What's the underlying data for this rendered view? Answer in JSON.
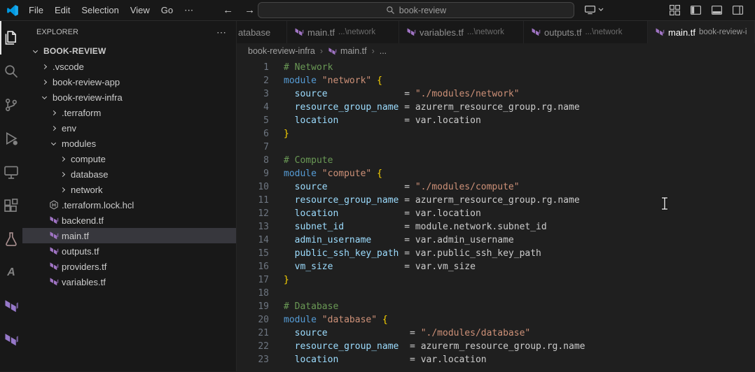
{
  "colors": {
    "tf-purple": "#a074c4",
    "c-comment": "#6a9955",
    "c-keyword": "#569cd6",
    "c-string": "#ce9178",
    "c-bracket": "#ffd700",
    "c-prop": "#9cdcfe",
    "c-plain": "#cccccc"
  },
  "titlebar": {
    "menus": [
      {
        "key": "file",
        "label": "File"
      },
      {
        "key": "edit",
        "label": "Edit"
      },
      {
        "key": "selection",
        "label": "Selection"
      },
      {
        "key": "view",
        "label": "View"
      },
      {
        "key": "go",
        "label": "Go"
      },
      {
        "key": "more",
        "label": "⋯"
      }
    ],
    "back_arrow": "←",
    "forward_arrow": "→",
    "search_value": "book-review"
  },
  "activitybar": {
    "items": [
      {
        "name": "explorer",
        "icon": "files",
        "active": true
      },
      {
        "name": "search",
        "icon": "search"
      },
      {
        "name": "source-control",
        "icon": "scm"
      },
      {
        "name": "run-debug",
        "icon": "debug"
      },
      {
        "name": "remote-explorer",
        "icon": "remote"
      },
      {
        "name": "extensions",
        "icon": "ext"
      },
      {
        "name": "testing",
        "icon": "flask",
        "color": "#a98f8f"
      },
      {
        "name": "azure-terraform",
        "icon": "letterA"
      },
      {
        "name": "terraform",
        "icon": "tf",
        "color": "#9678c9"
      },
      {
        "name": "terraform-cloud",
        "icon": "tf",
        "color": "#9678c9"
      }
    ]
  },
  "sidebar": {
    "title": "EXPLORER",
    "more": "⋯",
    "tree": [
      {
        "label": "BOOK-REVIEW",
        "depth": 0,
        "type": "folder",
        "chevron": "down",
        "bold": true
      },
      {
        "label": ".vscode",
        "depth": 1,
        "type": "folder",
        "chevron": "right"
      },
      {
        "label": "book-review-app",
        "depth": 1,
        "type": "folder",
        "chevron": "right"
      },
      {
        "label": "book-review-infra",
        "depth": 1,
        "type": "folder",
        "chevron": "down"
      },
      {
        "label": ".terraform",
        "depth": 2,
        "type": "folder",
        "chevron": "right"
      },
      {
        "label": "env",
        "depth": 2,
        "type": "folder",
        "chevron": "right"
      },
      {
        "label": "modules",
        "depth": 2,
        "type": "folder",
        "chevron": "down"
      },
      {
        "label": "compute",
        "depth": 3,
        "type": "folder",
        "chevron": "right"
      },
      {
        "label": "database",
        "depth": 3,
        "type": "folder",
        "chevron": "right"
      },
      {
        "label": "network",
        "depth": 3,
        "type": "folder",
        "chevron": "right"
      },
      {
        "label": ".terraform.lock.hcl",
        "depth": 2,
        "type": "file",
        "icon": "hcl"
      },
      {
        "label": "backend.tf",
        "depth": 2,
        "type": "file",
        "icon": "terraform"
      },
      {
        "label": "main.tf",
        "depth": 2,
        "type": "file",
        "icon": "terraform",
        "selected": true
      },
      {
        "label": "outputs.tf",
        "depth": 2,
        "type": "file",
        "icon": "terraform"
      },
      {
        "label": "providers.tf",
        "depth": 2,
        "type": "file",
        "icon": "terraform"
      },
      {
        "label": "variables.tf",
        "depth": 2,
        "type": "file",
        "icon": "terraform"
      }
    ]
  },
  "tabs": [
    {
      "label": "atabase",
      "desc": "",
      "icon": false,
      "active": false,
      "partial": true
    },
    {
      "label": "main.tf",
      "desc": "...\\network",
      "icon": true,
      "active": false
    },
    {
      "label": "variables.tf",
      "desc": "...\\network",
      "icon": true,
      "active": false
    },
    {
      "label": "outputs.tf",
      "desc": "...\\network",
      "icon": true,
      "active": false
    },
    {
      "label": "main.tf",
      "desc": "book-review-i",
      "icon": true,
      "active": true
    }
  ],
  "breadcrumb": {
    "items": [
      {
        "label": "book-review-infra",
        "icon": false
      },
      {
        "label": "main.tf",
        "icon": true
      },
      {
        "label": "...",
        "icon": false
      }
    ]
  },
  "editor": {
    "lines": [
      {
        "n": 1,
        "toks": [
          [
            "comment",
            "# Network"
          ]
        ]
      },
      {
        "n": 2,
        "toks": [
          [
            "keyword",
            "module"
          ],
          [
            "plain",
            " "
          ],
          [
            "string",
            "\"network\""
          ],
          [
            "plain",
            " "
          ],
          [
            "bracket",
            "{"
          ]
        ]
      },
      {
        "n": 3,
        "toks": [
          [
            "plain",
            "  "
          ],
          [
            "prop",
            "source"
          ],
          [
            "plain",
            "              = "
          ],
          [
            "string",
            "\"./modules/network\""
          ]
        ]
      },
      {
        "n": 4,
        "toks": [
          [
            "plain",
            "  "
          ],
          [
            "prop",
            "resource_group_name"
          ],
          [
            "plain",
            " = "
          ],
          [
            "plain",
            "azurerm_resource_group.rg.name"
          ]
        ]
      },
      {
        "n": 5,
        "toks": [
          [
            "plain",
            "  "
          ],
          [
            "prop",
            "location"
          ],
          [
            "plain",
            "            = "
          ],
          [
            "plain",
            "var.location"
          ]
        ]
      },
      {
        "n": 6,
        "toks": [
          [
            "bracket",
            "}"
          ]
        ]
      },
      {
        "n": 7,
        "toks": []
      },
      {
        "n": 8,
        "toks": [
          [
            "comment",
            "# Compute"
          ]
        ]
      },
      {
        "n": 9,
        "toks": [
          [
            "keyword",
            "module"
          ],
          [
            "plain",
            " "
          ],
          [
            "string",
            "\"compute\""
          ],
          [
            "plain",
            " "
          ],
          [
            "bracket",
            "{"
          ]
        ]
      },
      {
        "n": 10,
        "toks": [
          [
            "plain",
            "  "
          ],
          [
            "prop",
            "source"
          ],
          [
            "plain",
            "              = "
          ],
          [
            "string",
            "\"./modules/compute\""
          ]
        ]
      },
      {
        "n": 11,
        "toks": [
          [
            "plain",
            "  "
          ],
          [
            "prop",
            "resource_group_name"
          ],
          [
            "plain",
            " = "
          ],
          [
            "plain",
            "azurerm_resource_group.rg.name"
          ]
        ]
      },
      {
        "n": 12,
        "toks": [
          [
            "plain",
            "  "
          ],
          [
            "prop",
            "location"
          ],
          [
            "plain",
            "            = "
          ],
          [
            "plain",
            "var.location"
          ]
        ]
      },
      {
        "n": 13,
        "toks": [
          [
            "plain",
            "  "
          ],
          [
            "prop",
            "subnet_id"
          ],
          [
            "plain",
            "           = "
          ],
          [
            "plain",
            "module.network.subnet_id"
          ]
        ]
      },
      {
        "n": 14,
        "toks": [
          [
            "plain",
            "  "
          ],
          [
            "prop",
            "admin_username"
          ],
          [
            "plain",
            "      = "
          ],
          [
            "plain",
            "var.admin_username"
          ]
        ]
      },
      {
        "n": 15,
        "toks": [
          [
            "plain",
            "  "
          ],
          [
            "prop",
            "public_ssh_key_path"
          ],
          [
            "plain",
            " = "
          ],
          [
            "plain",
            "var.public_ssh_key_path"
          ]
        ]
      },
      {
        "n": 16,
        "toks": [
          [
            "plain",
            "  "
          ],
          [
            "prop",
            "vm_size"
          ],
          [
            "plain",
            "             = "
          ],
          [
            "plain",
            "var.vm_size"
          ]
        ]
      },
      {
        "n": 17,
        "toks": [
          [
            "bracket",
            "}"
          ]
        ]
      },
      {
        "n": 18,
        "toks": []
      },
      {
        "n": 19,
        "toks": [
          [
            "comment",
            "# Database"
          ]
        ]
      },
      {
        "n": 20,
        "toks": [
          [
            "keyword",
            "module"
          ],
          [
            "plain",
            " "
          ],
          [
            "string",
            "\"database\""
          ],
          [
            "plain",
            " "
          ],
          [
            "bracket",
            "{"
          ]
        ]
      },
      {
        "n": 21,
        "toks": [
          [
            "plain",
            "  "
          ],
          [
            "prop",
            "source"
          ],
          [
            "plain",
            "               = "
          ],
          [
            "string",
            "\"./modules/database\""
          ]
        ]
      },
      {
        "n": 22,
        "toks": [
          [
            "plain",
            "  "
          ],
          [
            "prop",
            "resource_group_name"
          ],
          [
            "plain",
            "  = "
          ],
          [
            "plain",
            "azurerm_resource_group.rg.name"
          ]
        ]
      },
      {
        "n": 23,
        "toks": [
          [
            "plain",
            "  "
          ],
          [
            "prop",
            "location"
          ],
          [
            "plain",
            "             = "
          ],
          [
            "plain",
            "var.location"
          ]
        ]
      }
    ]
  }
}
